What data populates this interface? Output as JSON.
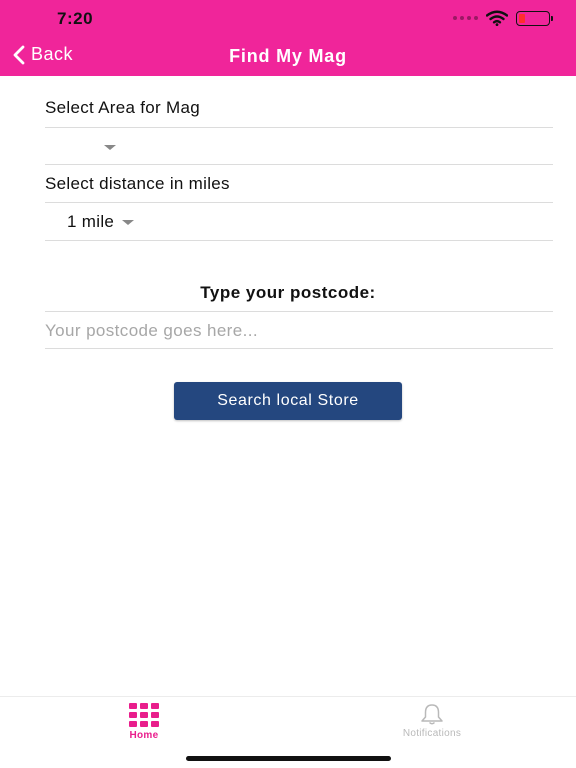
{
  "status_bar": {
    "time": "7:20",
    "battery_fill_percent": 20
  },
  "nav": {
    "back_label": "Back",
    "title": "Find My Mag"
  },
  "form": {
    "area_label": "Select Area for Mag",
    "area_value": "",
    "distance_label": "Select distance in miles",
    "distance_value": "1 mile",
    "postcode_heading": "Type your postcode:",
    "postcode_placeholder": "Your postcode goes here...",
    "postcode_value": "",
    "search_button_label": "Search local Store"
  },
  "tabbar": {
    "items": [
      {
        "label": "Home",
        "icon": "grid-icon",
        "active": true
      },
      {
        "label": "Notifications",
        "icon": "bell-icon",
        "active": false
      }
    ]
  },
  "colors": {
    "header_bg": "#f0259a",
    "button_bg": "#24477f",
    "active_tab": "#e91e8c",
    "inactive_tab": "#b9b9b9"
  }
}
